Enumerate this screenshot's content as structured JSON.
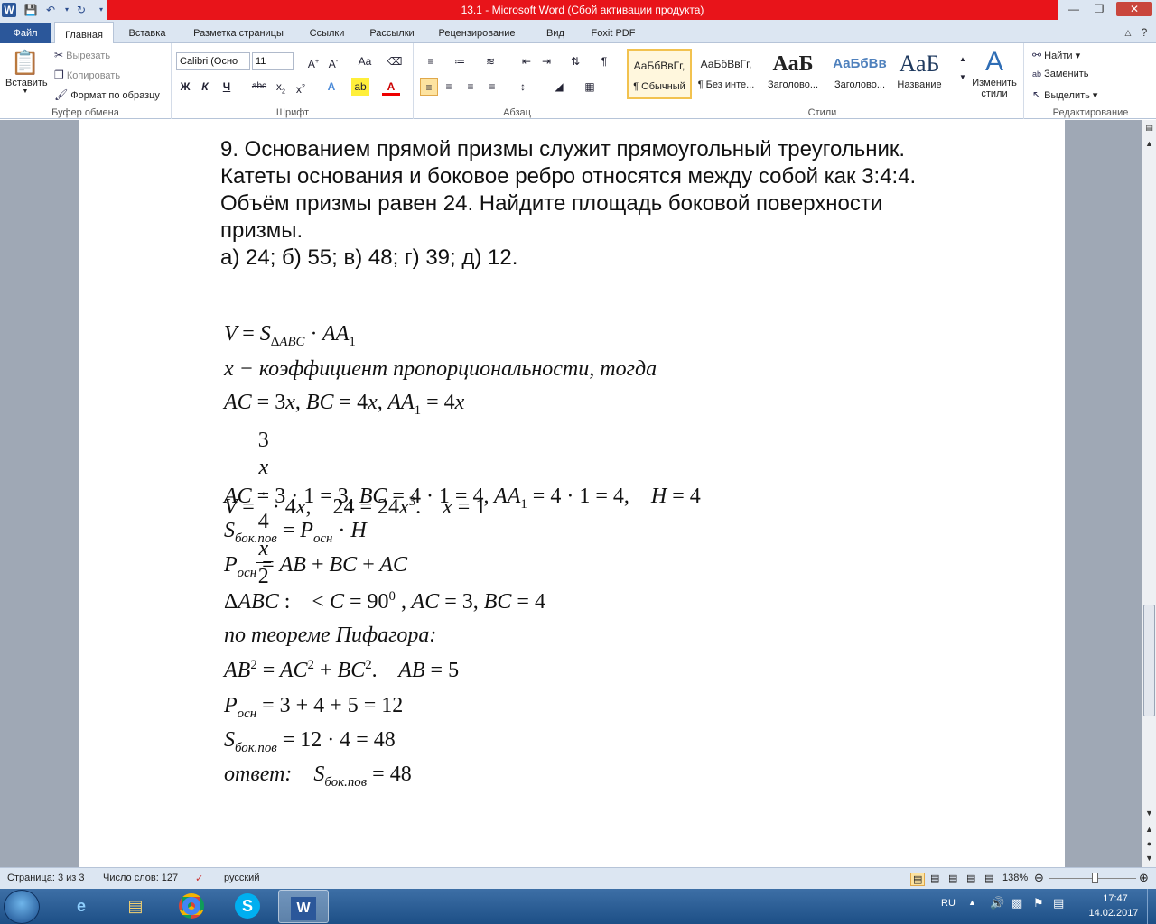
{
  "window": {
    "title": "13.1  -  Microsoft Word (Сбой активации продукта)"
  },
  "tabs": [
    "Файл",
    "Главная",
    "Вставка",
    "Разметка страницы",
    "Ссылки",
    "Рассылки",
    "Рецензирование",
    "Вид",
    "Foxit PDF"
  ],
  "clipboard": {
    "paste": "Вставить",
    "cut": "Вырезать",
    "copy": "Копировать",
    "format_painter": "Формат по образцу",
    "label": "Буфер обмена"
  },
  "font": {
    "name": "Calibri (Осно",
    "size": "11",
    "label": "Шрифт"
  },
  "paragraph": {
    "label": "Абзац"
  },
  "styles": {
    "items": [
      {
        "preview": "АаБбВвГг,",
        "name": "¶ Обычный"
      },
      {
        "preview": "АаБбВвГг,",
        "name": "¶ Без инте..."
      },
      {
        "preview": "АаБ",
        "name": "Заголово..."
      },
      {
        "preview": "АаБбВв",
        "name": "Заголово..."
      },
      {
        "preview": "АаБ",
        "name": "Название"
      }
    ],
    "change": "Изменить стили",
    "label": "Стили"
  },
  "editing": {
    "find": "Найти",
    "replace": "Заменить",
    "select": "Выделить",
    "label": "Редактирование"
  },
  "document": {
    "problem": [
      "9. Основанием прямой призмы служит прямоугольный треугольник.",
      "Катеты основания и боковое ребро относятся между собой как 3:4:4.",
      "Объём призмы равен 24. Найдите площадь боковой поверхности",
      "призмы.",
      "а) 24; б) 55; в) 48; г) 39; д) 12."
    ],
    "sol": {
      "l2": "x − коэффициент пропорциональности, тогда",
      "l9": "по теореме Пифагора:",
      "l12": "ответ:"
    }
  },
  "status": {
    "page": "Страница: 3 из 3",
    "words": "Число слов: 127",
    "lang": "русский",
    "zoom": "138%"
  },
  "tray": {
    "lang": "RU",
    "time": "17:47",
    "date": "14.02.2017"
  },
  "colors": {
    "title_red": "#e8141a",
    "file_tab": "#2b579a",
    "ribbon_bg": "#dce6f2",
    "taskbar": "#1d4f86"
  }
}
